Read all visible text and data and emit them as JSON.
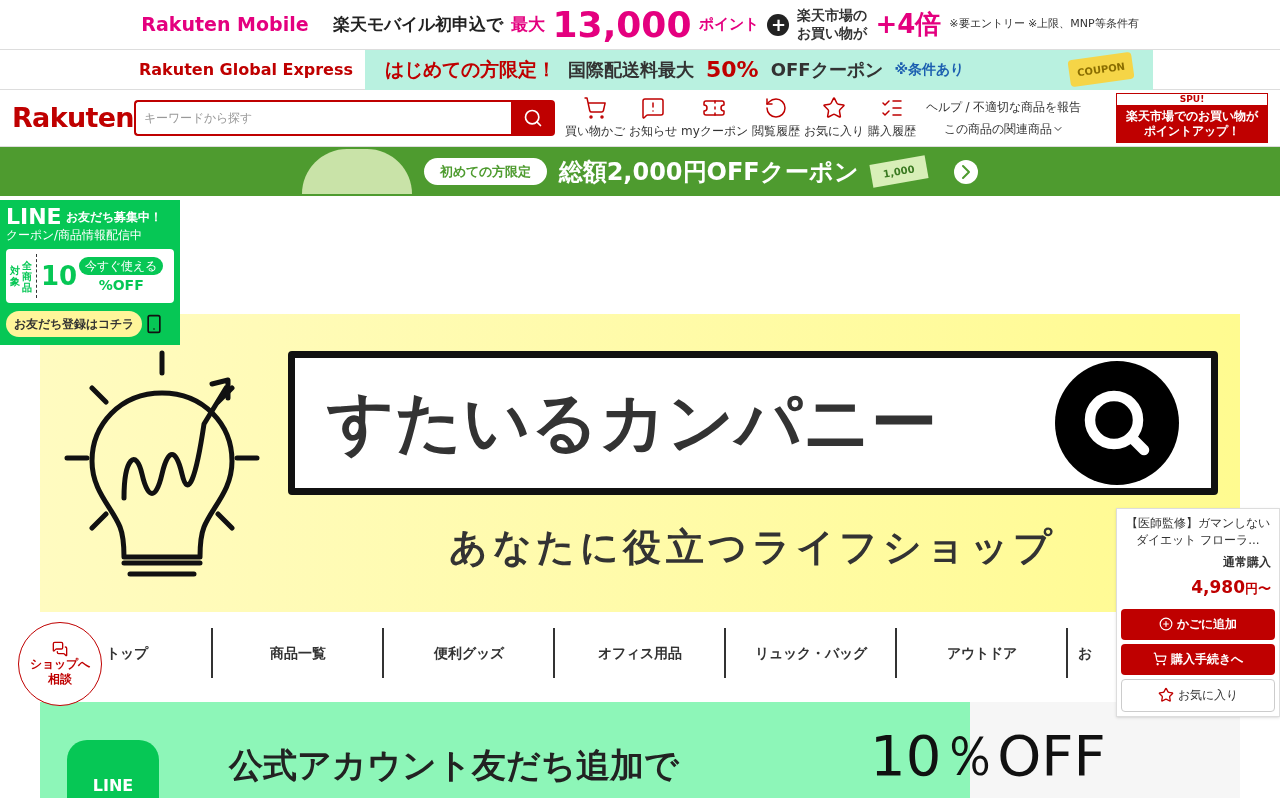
{
  "mobile_banner": {
    "brand": "Rakuten Mobile",
    "text_1": "楽天モバイル初申込で",
    "text_2": "最大",
    "points": "13,000",
    "points_unit": "ポイント",
    "plus": "+",
    "text_3": "楽天市場の",
    "text_4": "お買い物が",
    "multiplier": "+4倍",
    "note": "※要エントリー ※上限、MNP等条件有"
  },
  "express_banner": {
    "brand": "Rakuten Global Express",
    "headline": "はじめての方限定！",
    "text": "国際配送料最大",
    "discount": "50%",
    "offer": "OFFクーポン",
    "note": "※条件あり",
    "ticket": "COUPON"
  },
  "header": {
    "logo": "Rakuten",
    "search": {
      "placeholder": "キーワードから探す"
    },
    "nav": [
      {
        "kind": "cart",
        "label": "買い物かご"
      },
      {
        "kind": "notice",
        "label": "お知らせ"
      },
      {
        "kind": "coupon",
        "label": "myクーポン"
      },
      {
        "kind": "history",
        "label": "閲覧履歴"
      },
      {
        "kind": "favorite",
        "label": "お気に入り"
      },
      {
        "kind": "orders",
        "label": "購入履歴"
      }
    ],
    "help_link": "ヘルプ / 不適切な商品を報告",
    "related_link": "この商品の関連商品",
    "spu": {
      "tag": "SPU!",
      "text_1": "楽天市場でのお買い物が",
      "text_2": "ポイントアップ！"
    }
  },
  "coupon_banner": {
    "badge": "初めての方限定",
    "text": "総額2,000円OFFクーポン",
    "bill": "1,000"
  },
  "line_widget": {
    "logo": "LINE",
    "title": "お友だち募集中！",
    "subtitle": "クーポン/商品情報配信中",
    "target_1": "対象",
    "target_2": "全商品",
    "value": "10",
    "unit": "%OFF",
    "tag": "今すぐ使える",
    "cta": "お友だち登録はコチラ"
  },
  "shop_banner": {
    "name": "すたいるカンパニー",
    "tagline": "あなたに役立つライフショップ"
  },
  "shop_nav": [
    {
      "label": "トップ"
    },
    {
      "label": "商品一覧"
    },
    {
      "label": "便利グッズ"
    },
    {
      "label": "オフィス用品"
    },
    {
      "label": "リュック・バッグ"
    },
    {
      "label": "アウトドア"
    },
    {
      "label": "お"
    }
  ],
  "chat_button": {
    "line_1": "ショップへ",
    "line_2": "相談"
  },
  "product_card": {
    "title": "【医師監修】ガマンしないダイエット フローラ...",
    "purchase_type": "通常購入",
    "price": "4,980",
    "price_suffix": "円〜",
    "buttons": [
      {
        "kind": "cart",
        "label": "かごに追加"
      },
      {
        "kind": "checkout",
        "label": "購入手続きへ"
      },
      {
        "kind": "favorite",
        "label": "お気に入り"
      }
    ]
  },
  "line_promo": {
    "logo": "LINE",
    "text_1": "公式アカウント友だち追加で",
    "discount": "10％OFF"
  }
}
